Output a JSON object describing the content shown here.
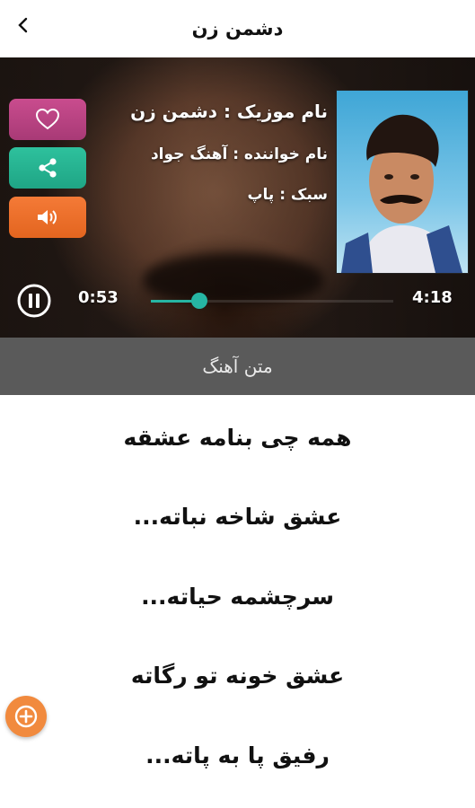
{
  "header": {
    "title": "دشمن زن",
    "back_icon": "chevron-left-icon"
  },
  "player": {
    "song_name_line": "نام موزیک : دشمن زن",
    "singer_line": "نام خواننده : آهنگ جواد",
    "genre_line": "سبک : پاپ",
    "current_time": "0:53",
    "total_time": "4:18",
    "progress": 0.2,
    "actions": {
      "like_icon": "heart-icon",
      "share_icon": "share-icon",
      "volume_icon": "speaker-icon"
    },
    "colors": {
      "like": "#c94c8e",
      "share": "#2ec19d",
      "volume": "#f47a37",
      "accent": "#26b5a3"
    }
  },
  "lyrics_tab": {
    "label": "متن آهنگ"
  },
  "lyrics": [
    "همه چی بنامه عشقه",
    "عشق شاخه نباته...",
    "سرچشمه حیاته...",
    "عشق خونه تو رگاته",
    "رفیق پا به پاته..."
  ],
  "fab_icon": "plus-icon"
}
